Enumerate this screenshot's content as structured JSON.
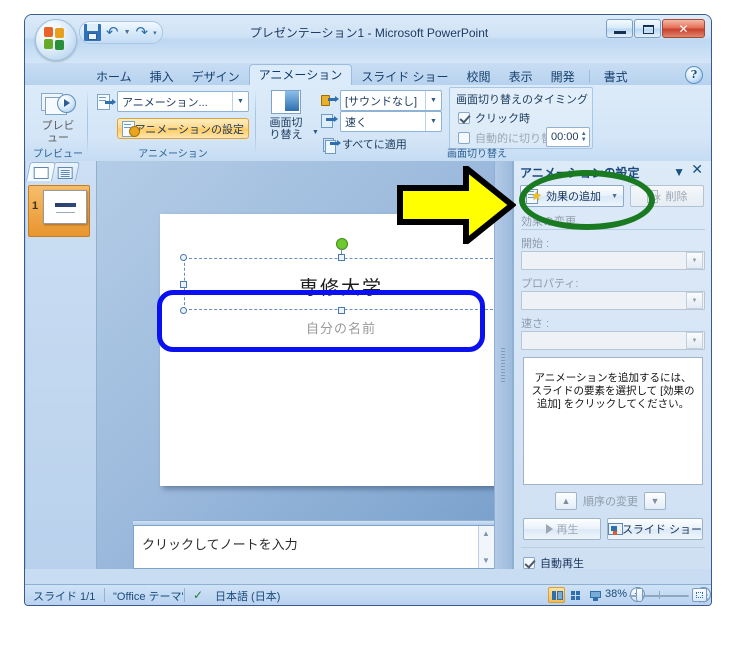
{
  "window": {
    "title": "プレゼンテーション1 - Microsoft PowerPoint",
    "minimize": "minimize-button",
    "maximize": "maximize-button",
    "close": "close-button"
  },
  "quick_access": {
    "save": "save-icon",
    "undo": "undo-icon",
    "redo": "redo-icon",
    "customize": "customize-qat-icon"
  },
  "tabs": [
    {
      "label": "ホーム",
      "active": false
    },
    {
      "label": "挿入",
      "active": false
    },
    {
      "label": "デザイン",
      "active": false
    },
    {
      "label": "アニメーション",
      "active": true
    },
    {
      "label": "スライド ショー",
      "active": false
    },
    {
      "label": "校閲",
      "active": false
    },
    {
      "label": "表示",
      "active": false
    },
    {
      "label": "開発",
      "active": false
    },
    {
      "label": "書式",
      "active": false
    }
  ],
  "help_button": "?",
  "ribbon": {
    "groups": [
      {
        "name": "プレビュー"
      },
      {
        "name": "アニメーション"
      },
      {
        "name": "画面切り替え"
      }
    ],
    "preview": {
      "button_label": "プレビュー"
    },
    "animation": {
      "combo_value": "アニメーション...",
      "custom_animation_label": "アニメーションの設定"
    },
    "transition": {
      "gallery_label_line1": "画面切",
      "gallery_label_line2": "り替え",
      "sound_value": "[サウンドなし]",
      "speed_value": "速く",
      "apply_all_label": "すべてに適用",
      "timing_title": "画面切り替えのタイミング",
      "on_click_label": "クリック時",
      "on_click_checked": true,
      "auto_advance_label": "自動的に切り替え:",
      "auto_advance_checked": false,
      "auto_advance_value": "00:00"
    }
  },
  "outline_pane": {
    "tab_slides": "slides-tab",
    "tab_outline": "outline-tab",
    "slide_number": "1"
  },
  "slide": {
    "title_text": "専修大学",
    "subtitle_text": "自分の名前"
  },
  "notes": {
    "placeholder": "クリックしてノートを入力"
  },
  "task_pane": {
    "title": "アニメーションの設定",
    "dropdown_icon": "chevron-down-icon",
    "close_icon": "close-icon",
    "add_effect_label": "効果の追加",
    "remove_label": "削除",
    "change_effect_label": "効果の変更",
    "start_label": "開始 :",
    "start_value": "",
    "property_label": "プロパティ:",
    "property_value": "",
    "speed_label": "速さ :",
    "speed_value": "",
    "empty_message": "アニメーションを追加するには、スライドの要素を選択して [効果の追加] をクリックしてください。",
    "reorder_label": "順序の変更",
    "reorder_up_icon": "arrow-up-icon",
    "reorder_down_icon": "arrow-down-icon",
    "play_label": "再生",
    "slideshow_label": "スライド ショー",
    "autoplay_label": "自動再生",
    "autoplay_checked": true
  },
  "status_bar": {
    "slide_counter": "スライド 1/1",
    "theme": "\"Office テーマ\"",
    "language": "日本語 (日本)",
    "spellcheck_icon": "spellcheck-icon",
    "view_normal": "normal-view-button",
    "view_sorter": "slide-sorter-button",
    "view_show": "slideshow-view-button",
    "zoom_level": "38%",
    "zoom_out": "−",
    "zoom_in": "+",
    "fit_button": "fit-slide-button"
  },
  "annotations": {
    "arrow": "yellow-arrow-annotation",
    "ellipse_color": "#1a7a22",
    "rect_color": "#0b10f0",
    "arrow_color": "#ffff00"
  }
}
